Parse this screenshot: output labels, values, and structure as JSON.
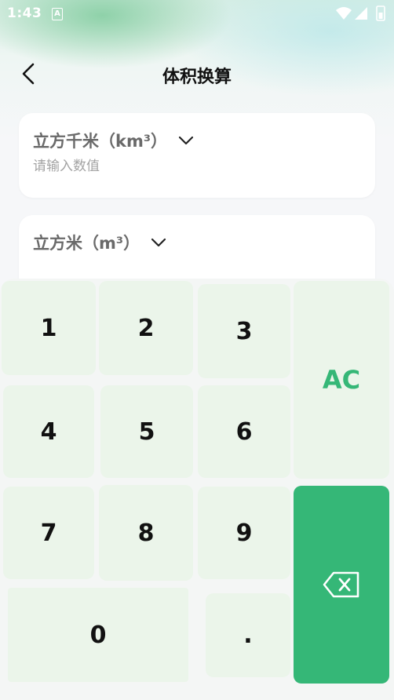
{
  "status_bar": {
    "time": "1:43",
    "notification_badge": "A",
    "icons": [
      "wifi-icon",
      "signal-icon",
      "battery-icon"
    ]
  },
  "header": {
    "title": "体积换算",
    "back_icon": "chevron-left-icon"
  },
  "converter": {
    "from": {
      "unit_label": "立方千米（km³）",
      "value": "",
      "placeholder": "请输入数值"
    },
    "to": {
      "unit_label": "立方米（m³）",
      "value": ""
    }
  },
  "keypad": {
    "keys": {
      "k1": "1",
      "k2": "2",
      "k3": "3",
      "k4": "4",
      "k5": "5",
      "k6": "6",
      "k7": "7",
      "k8": "8",
      "k9": "9",
      "k0": "0",
      "dot": ".",
      "ac": "AC"
    },
    "backspace_icon": "backspace-icon"
  },
  "colors": {
    "accent": "#35b777",
    "key_background": "#ebf5ea",
    "page_background": "#f6f7f9"
  }
}
